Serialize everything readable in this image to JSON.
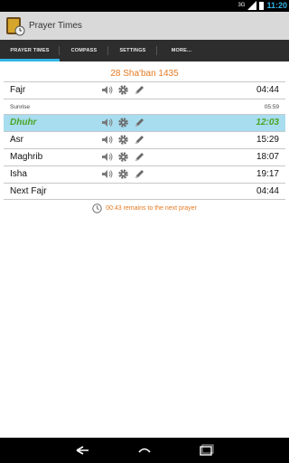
{
  "status_bar": {
    "signal": "3G",
    "clock": "11:20"
  },
  "app": {
    "title": "Prayer Times"
  },
  "tabs": [
    "PRAYER TIMES",
    "COMPASS",
    "SETTINGS",
    "MORE..."
  ],
  "date": "28 Sha'ban 1435",
  "prayers": [
    {
      "name": "Fajr",
      "time": "04:44",
      "icons": true
    },
    {
      "name": "Sunrise",
      "time": "05:59",
      "icons": false
    },
    {
      "name": "Dhuhr",
      "time": "12:03",
      "icons": true,
      "active": true
    },
    {
      "name": "Asr",
      "time": "15:29",
      "icons": true
    },
    {
      "name": "Maghrib",
      "time": "18:07",
      "icons": true
    },
    {
      "name": "Isha",
      "time": "19:17",
      "icons": true
    },
    {
      "name": "Next Fajr",
      "time": "04:44",
      "icons": false
    }
  ],
  "remains_text": "00:43 remains to the next prayer",
  "colors": {
    "accent": "#33b5e5",
    "orange": "#e67a22",
    "active_row": "#a8dcef",
    "active_text": "#49a624"
  },
  "icon_names": {
    "sound": "speaker-icon",
    "settings": "gear-icon",
    "edit": "pencil-icon",
    "clock": "clock-icon"
  }
}
